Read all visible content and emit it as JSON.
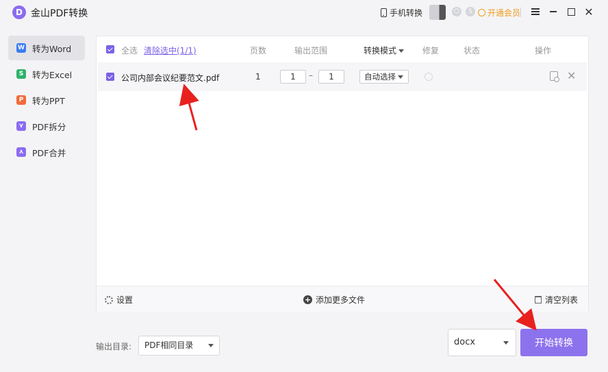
{
  "titlebar": {
    "logo_letter": "D",
    "app_title": "金山PDF转换",
    "mobile_convert": "手机转换",
    "vip_label": "开通会员"
  },
  "sidebar": {
    "items": [
      {
        "label": "转为Word",
        "icon": "W",
        "color": "#3b7cf0"
      },
      {
        "label": "转为Excel",
        "icon": "S",
        "color": "#2fb26a"
      },
      {
        "label": "转为PPT",
        "icon": "P",
        "color": "#f26b3a"
      },
      {
        "label": "PDF拆分",
        "icon": "split",
        "color": "#8b6cf0"
      },
      {
        "label": "PDF合并",
        "icon": "merge",
        "color": "#8b6cf0"
      }
    ]
  },
  "table": {
    "select_all": "全选",
    "clear_selection": "清除选中(1/1)",
    "headers": {
      "pages": "页数",
      "output_range": "输出范围",
      "convert_mode": "转换模式",
      "repair": "修复",
      "status": "状态",
      "actions": "操作"
    },
    "rows": [
      {
        "filename": "公司内部会议纪要范文.pdf",
        "pages": "1",
        "range_from": "1",
        "range_sep": "–",
        "range_to": "1",
        "mode": "自动选择"
      }
    ]
  },
  "footer": {
    "settings": "设置",
    "add_more": "添加更多文件",
    "clear_list": "清空列表"
  },
  "bottom": {
    "output_dir_label": "输出目录:",
    "output_dir_value": "PDF相同目录",
    "format_value": "docx",
    "start_button": "开始转换"
  },
  "colors": {
    "accent": "#7b61e8",
    "annotation_arrow": "#e8211f"
  }
}
